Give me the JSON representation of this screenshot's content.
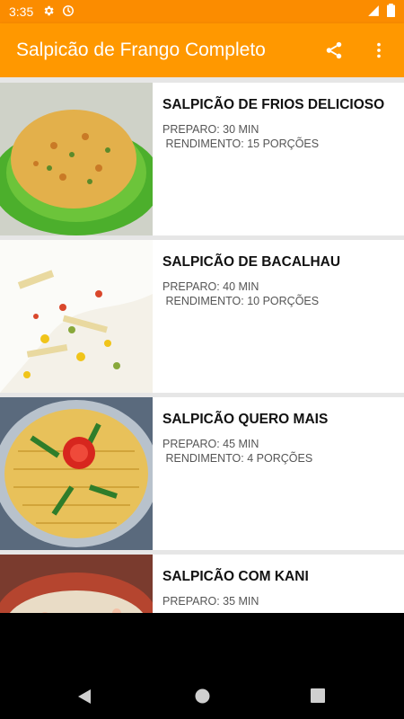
{
  "status_bar": {
    "time": "3:35",
    "left_icons": [
      "gear-icon",
      "sync-icon"
    ],
    "right_icons": [
      "signal-icon",
      "battery-icon"
    ]
  },
  "app_bar": {
    "title": "Salpicão de Frango Completo",
    "actions": [
      "share-icon",
      "more-vert-icon"
    ]
  },
  "colors": {
    "status_bar": "#fb8c00",
    "app_bar": "#ff9800",
    "list_background": "#e6e6e6",
    "card_background": "#ffffff",
    "nav_bar": "#000000"
  },
  "recipes": [
    {
      "title": "SALPICÃO DE FRIOS DELICIOSO",
      "prep": "PREPARO: 30 MIN",
      "yield": " RENDIMENTO: 15 PORÇÕES"
    },
    {
      "title": "SALPICÃO DE BACALHAU",
      "prep": "PREPARO: 40 MIN",
      "yield": " RENDIMENTO: 10 PORÇÕES"
    },
    {
      "title": "SALPICÃO QUERO MAIS",
      "prep": "PREPARO: 45 MIN",
      "yield": " RENDIMENTO: 4 PORÇÕES"
    },
    {
      "title": "SALPICÃO COM KANI",
      "prep": "PREPARO: 35 MIN",
      "yield": ""
    }
  ],
  "nav_bar": {
    "buttons": [
      "back-icon",
      "home-icon",
      "recents-icon"
    ]
  }
}
